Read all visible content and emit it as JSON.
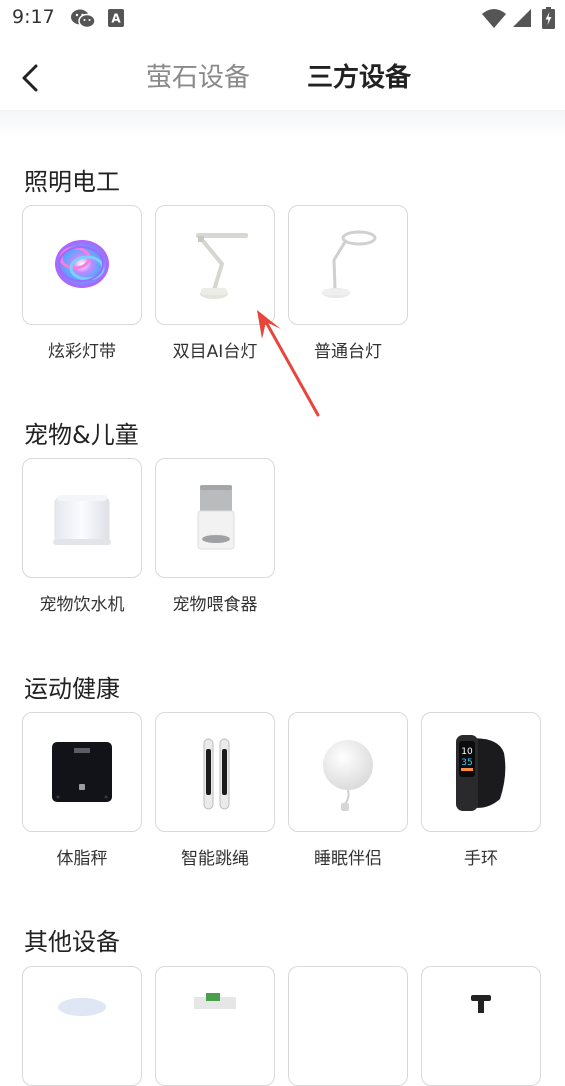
{
  "status_bar": {
    "time": "9:17",
    "icons": [
      "wechat-icon",
      "a-badge-icon",
      "wifi-icon",
      "signal-icon",
      "battery-charging-icon"
    ],
    "a_badge": "A"
  },
  "header": {
    "back_icon": "chevron-left-icon",
    "tabs": [
      {
        "label": "萤石设备",
        "active": false
      },
      {
        "label": "三方设备",
        "active": true
      }
    ],
    "active_color": "#222222",
    "inactive_color": "#8a8a8a"
  },
  "sections": [
    {
      "title": "照明电工",
      "items": [
        {
          "label": "炫彩灯带",
          "icon": "led-strip-icon"
        },
        {
          "label": "双目AI台灯",
          "icon": "dual-ai-desk-lamp-icon"
        },
        {
          "label": "普通台灯",
          "icon": "desk-lamp-icon"
        }
      ]
    },
    {
      "title": "宠物&儿童",
      "items": [
        {
          "label": "宠物饮水机",
          "icon": "pet-water-fountain-icon"
        },
        {
          "label": "宠物喂食器",
          "icon": "pet-feeder-icon"
        }
      ]
    },
    {
      "title": "运动健康",
      "items": [
        {
          "label": "体脂秤",
          "icon": "body-fat-scale-icon"
        },
        {
          "label": "智能跳绳",
          "icon": "smart-jump-rope-icon"
        },
        {
          "label": "睡眠伴侣",
          "icon": "sleep-companion-icon"
        },
        {
          "label": "手环",
          "icon": "fitness-band-icon"
        }
      ]
    },
    {
      "title": "其他设备",
      "items": [
        {
          "label": "",
          "icon": "other-device-1-icon"
        },
        {
          "label": "",
          "icon": "other-device-2-icon"
        },
        {
          "label": "",
          "icon": "other-device-3-icon"
        },
        {
          "label": "",
          "icon": "other-device-4-icon"
        }
      ]
    }
  ],
  "annotation": {
    "icon": "red-arrow-icon",
    "color": "#e8453c"
  },
  "colors": {
    "tile_border": "#d9d9d9",
    "background": "#ffffff",
    "header_fade": "#f4f5f7"
  }
}
